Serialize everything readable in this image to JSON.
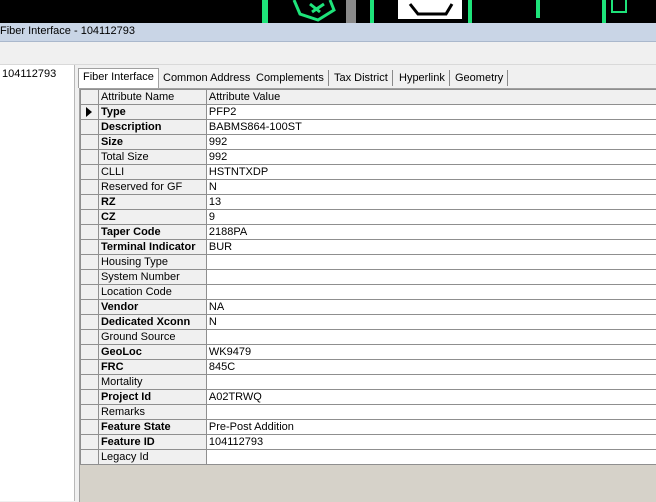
{
  "window": {
    "title": "Fiber Interface - 104112793"
  },
  "tree": {
    "selected_item": "104112793"
  },
  "tabs": [
    {
      "label": "Fiber Interface",
      "active": true
    },
    {
      "label": "Common Address",
      "active": false
    },
    {
      "label": "Complements",
      "active": false
    },
    {
      "label": "Tax District",
      "active": false
    },
    {
      "label": "Hyperlink",
      "active": false
    },
    {
      "label": "Geometry",
      "active": false
    }
  ],
  "grid": {
    "headers": {
      "name": "Attribute Name",
      "value": "Attribute Value"
    },
    "rows": [
      {
        "name": "Type",
        "value": "PFP2",
        "bold": true,
        "current": true
      },
      {
        "name": "Description",
        "value": "BABMS864-100ST",
        "bold": true
      },
      {
        "name": "Size",
        "value": "992",
        "bold": true
      },
      {
        "name": "Total Size",
        "value": "992",
        "bold": false
      },
      {
        "name": "CLLI",
        "value": "HSTNTXDP",
        "bold": false
      },
      {
        "name": "Reserved for GF",
        "value": "N",
        "bold": false
      },
      {
        "name": "RZ",
        "value": "13",
        "bold": true
      },
      {
        "name": "CZ",
        "value": "9",
        "bold": true
      },
      {
        "name": "Taper Code",
        "value": "2188PA",
        "bold": true
      },
      {
        "name": "Terminal Indicator",
        "value": "BUR",
        "bold": true
      },
      {
        "name": "Housing Type",
        "value": "",
        "bold": false
      },
      {
        "name": "System Number",
        "value": "",
        "bold": false
      },
      {
        "name": "Location Code",
        "value": "",
        "bold": false
      },
      {
        "name": "Vendor",
        "value": "NA",
        "bold": true
      },
      {
        "name": "Dedicated Xconn",
        "value": "N",
        "bold": true
      },
      {
        "name": "Ground Source",
        "value": "",
        "bold": false
      },
      {
        "name": "GeoLoc",
        "value": "WK9479",
        "bold": true
      },
      {
        "name": "FRC",
        "value": "845C",
        "bold": true
      },
      {
        "name": "Mortality",
        "value": "",
        "bold": false
      },
      {
        "name": "Project Id",
        "value": "A02TRWQ",
        "bold": true
      },
      {
        "name": "Remarks",
        "value": "",
        "bold": false
      },
      {
        "name": "Feature State",
        "value": "Pre-Post Addition",
        "bold": true
      },
      {
        "name": "Feature ID",
        "value": "104112793",
        "bold": true
      },
      {
        "name": "Legacy Id",
        "value": "",
        "bold": false
      }
    ]
  },
  "colors": {
    "map_line": "#1ee37a",
    "title_bar": "#c9d5e6",
    "grid_background": "#d6d2c9"
  }
}
